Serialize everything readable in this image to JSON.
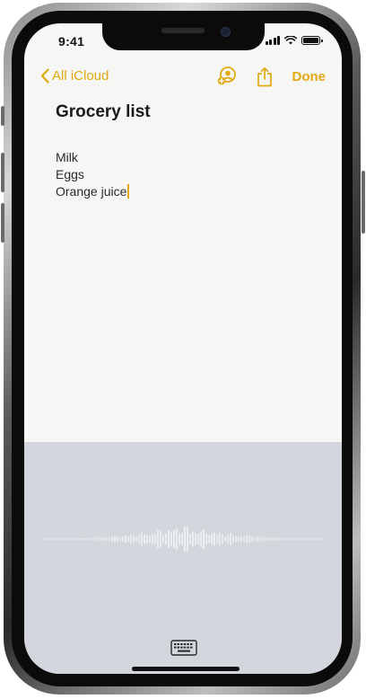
{
  "status_bar": {
    "time": "9:41"
  },
  "nav": {
    "back_label": "All iCloud",
    "done_label": "Done"
  },
  "note": {
    "title": "Grocery list",
    "lines": [
      "Milk",
      "Eggs",
      "Orange juice"
    ]
  },
  "colors": {
    "accent": "#e0a90f",
    "note_background": "#f6f6f5",
    "dictation_background": "#d3d6dc"
  },
  "icons": {
    "back": "chevron-left-icon",
    "collaborate": "add-people-icon",
    "share": "share-icon",
    "keyboard": "keyboard-icon"
  }
}
